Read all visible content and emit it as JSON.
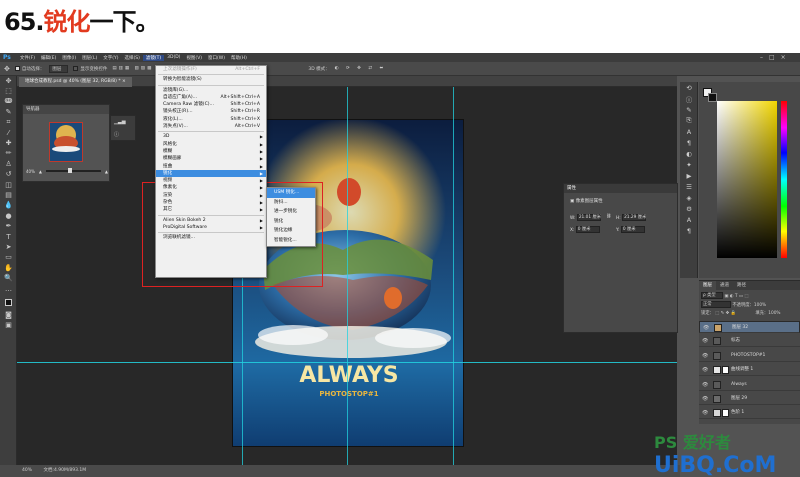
{
  "step_title": {
    "number": "65.",
    "highlight": "锐化",
    "rest": "一下。"
  },
  "app": {
    "logo": "Ps"
  },
  "menubar": [
    "文件(F)",
    "编辑(E)",
    "图像(I)",
    "图层(L)",
    "文字(Y)",
    "选择(S)",
    "滤镜(T)",
    "3D(D)",
    "视图(V)",
    "窗口(W)",
    "帮助(H)"
  ],
  "menubar_active": "滤镜(T)",
  "window_buttons": [
    "–",
    "□",
    "×"
  ],
  "options_bar": {
    "auto_select_label": "自动选择：",
    "auto_select_value": "图层",
    "show_transform_label": "显示变换控件",
    "mode_label": "3D 模式："
  },
  "document_tab": "地球合成教程.psd @ 40% (图层 32, RGB/8) * ×",
  "navigator": {
    "title": "导航器",
    "zoom": "40%"
  },
  "filter_menu": {
    "items": [
      {
        "label": "上次滤镜操作(F)",
        "shortcut": "Alt+Ctrl+F",
        "disabled": true
      },
      {
        "sep": true
      },
      {
        "label": "转换为智能滤镜(S)",
        "shortcut": ""
      },
      {
        "sep": true
      },
      {
        "label": "滤镜库(G)...",
        "shortcut": ""
      },
      {
        "label": "自适应广角(A)...",
        "shortcut": "Alt+Shift+Ctrl+A"
      },
      {
        "label": "Camera Raw 滤镜(C)...",
        "shortcut": "Shift+Ctrl+A"
      },
      {
        "label": "镜头校正(R)...",
        "shortcut": "Shift+Ctrl+R"
      },
      {
        "label": "液化(L)...",
        "shortcut": "Shift+Ctrl+X"
      },
      {
        "label": "消失点(V)...",
        "shortcut": "Alt+Ctrl+V"
      },
      {
        "sep": true
      },
      {
        "label": "3D",
        "sub": true
      },
      {
        "label": "风格化",
        "sub": true
      },
      {
        "label": "模糊",
        "sub": true
      },
      {
        "label": "模糊画廊",
        "sub": true
      },
      {
        "label": "扭曲",
        "sub": true
      },
      {
        "label": "锐化",
        "sub": true,
        "highlight": true
      },
      {
        "label": "视频",
        "sub": true
      },
      {
        "label": "像素化",
        "sub": true
      },
      {
        "label": "渲染",
        "sub": true
      },
      {
        "label": "杂色",
        "sub": true
      },
      {
        "label": "其它",
        "sub": true
      },
      {
        "sep": true
      },
      {
        "label": "Alien Skin Bokeh 2",
        "sub": true
      },
      {
        "label": "ProDigital Software",
        "sub": true
      },
      {
        "sep": true
      },
      {
        "label": "浏览联机滤镜...",
        "shortcut": ""
      }
    ]
  },
  "sharpen_submenu": [
    {
      "label": "USM 锐化...",
      "highlight": true
    },
    {
      "label": "防抖..."
    },
    {
      "label": "进一步锐化"
    },
    {
      "label": "锐化"
    },
    {
      "label": "锐化边缘"
    },
    {
      "label": "智能锐化..."
    }
  ],
  "properties": {
    "title": "属性",
    "subtitle": "像素图层属性",
    "w_label": "W:",
    "w_value": "21.01 厘米",
    "h_label": "H:",
    "h_value": "21.29 厘米",
    "x_label": "X:",
    "x_value": "0 厘米",
    "y_label": "Y:",
    "y_value": "0 厘米"
  },
  "poster": {
    "headline": "ALWAYS",
    "subline": "PHOTOSTOP#1"
  },
  "layers_panel": {
    "tabs": [
      "图层",
      "通道",
      "路径"
    ],
    "kind_label": "ρ 类型",
    "blend_mode": "正常",
    "opacity_label": "不透明度：",
    "opacity_value": "100%",
    "lock_label": "锁定：",
    "fill_label": "填充：",
    "fill_value": "100%",
    "layers": [
      {
        "name": "图层 32",
        "selected": true
      },
      {
        "name": "标志"
      },
      {
        "name": "PHOTOSTOP#1"
      },
      {
        "name": "曲线调整 1"
      },
      {
        "name": "Always"
      },
      {
        "name": "图层 29"
      },
      {
        "name": "色阶 1"
      }
    ]
  },
  "status_bar": {
    "zoom": "40%",
    "doc": "文档:4.90M/893.1M"
  },
  "watermark": {
    "line1": "PS 爱好者",
    "line2": "UiBQ.CoM"
  }
}
